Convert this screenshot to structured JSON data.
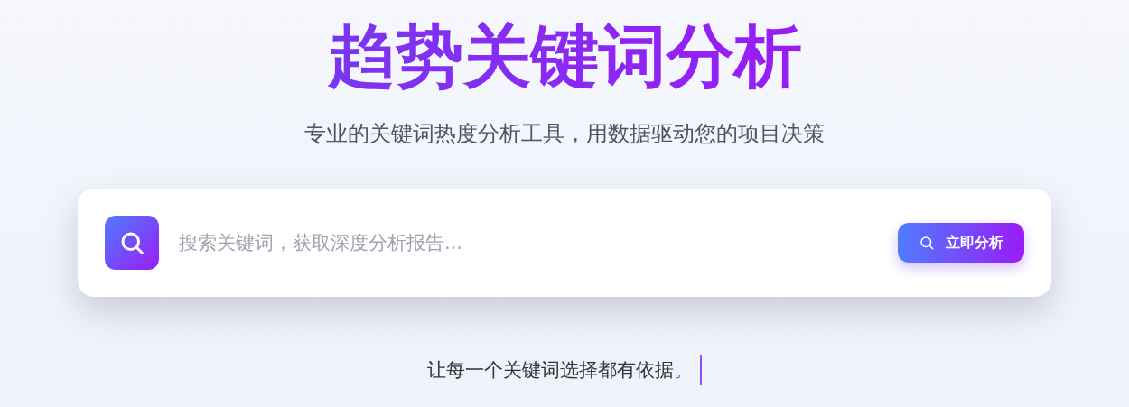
{
  "title": "趋势关键词分析",
  "subtitle": "专业的关键词热度分析工具，用数据驱动您的项目决策",
  "search": {
    "placeholder": "搜索关键词，获取深度分析报告...",
    "button": "立即分析"
  },
  "tagline": "让每一个关键词选择都有依据。"
}
